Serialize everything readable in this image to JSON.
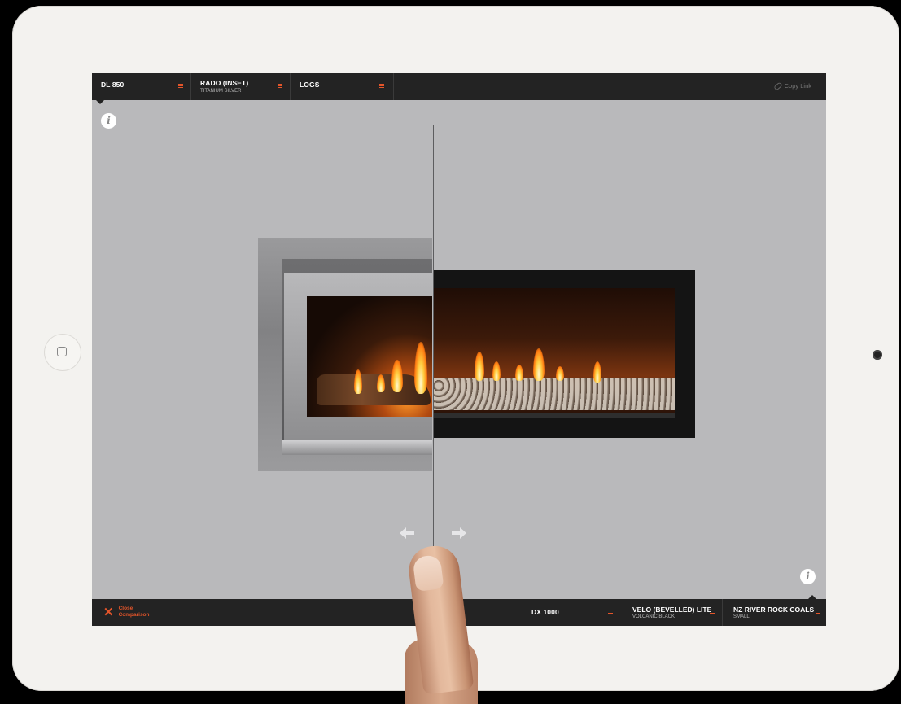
{
  "device": {
    "home_button": "home-button-square-icon",
    "camera": "front-camera"
  },
  "top_bar": {
    "segments": [
      {
        "title": "DL 850",
        "subtitle": ""
      },
      {
        "title": "RADO (INSET)",
        "subtitle": "TITANIUM SILVER"
      },
      {
        "title": "LOGS",
        "subtitle": ""
      }
    ],
    "copy_link": "Copy Link",
    "menu_icon": "hamburger-icon",
    "link_icon": "link-icon"
  },
  "comparison": {
    "left_product": "DL 850 RADO (INSET) with LOGS",
    "right_product": "DX 1000 VELO (BEVELLED) LITE with NZ RIVER ROCK COALS",
    "info_icon": "i",
    "prev_icon": "arrow-left-icon",
    "next_icon": "arrow-right-icon"
  },
  "bottom_bar": {
    "close_label": "Close Comparison",
    "segments": [
      {
        "title": "DX 1000",
        "subtitle": ""
      },
      {
        "title": "VELO (BEVELLED) LITE",
        "subtitle": "VOLCANIC BLACK"
      },
      {
        "title": "NZ RIVER ROCK COALS",
        "subtitle": "SMALL"
      }
    ]
  },
  "colors": {
    "accent": "#e4552a",
    "bar": "#232323",
    "canvas": "#b9b9bb"
  }
}
